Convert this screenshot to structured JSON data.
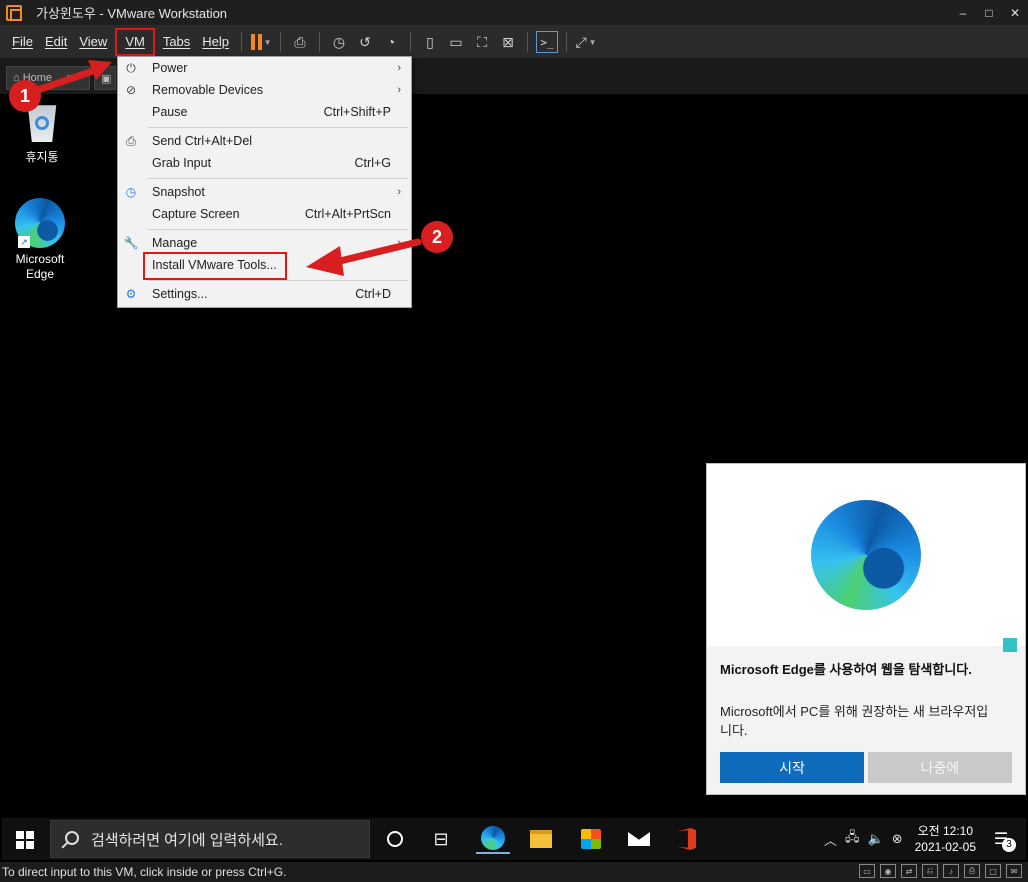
{
  "window": {
    "title": "가상윈도우 - VMware Workstation",
    "controls": [
      "–",
      "□",
      "✕"
    ]
  },
  "menubar": {
    "items": [
      "File",
      "Edit",
      "View",
      "VM",
      "Tabs",
      "Help"
    ]
  },
  "tabs": {
    "home_label": "Home"
  },
  "vm_menu": {
    "items": [
      {
        "label": "Power",
        "shortcut": "",
        "submenu": true,
        "icon": "power-icon"
      },
      {
        "label": "Removable Devices",
        "shortcut": "",
        "submenu": true,
        "icon": "disc-icon"
      },
      {
        "label": "Pause",
        "shortcut": "Ctrl+Shift+P",
        "submenu": false,
        "icon": ""
      },
      {
        "label": "Send Ctrl+Alt+Del",
        "shortcut": "",
        "submenu": false,
        "icon": "keyboard-icon"
      },
      {
        "label": "Grab Input",
        "shortcut": "Ctrl+G",
        "submenu": false,
        "icon": ""
      },
      {
        "label": "Snapshot",
        "shortcut": "",
        "submenu": true,
        "icon": "snapshot-icon"
      },
      {
        "label": "Capture Screen",
        "shortcut": "Ctrl+Alt+PrtScn",
        "submenu": false,
        "icon": ""
      },
      {
        "label": "Manage",
        "shortcut": "",
        "submenu": true,
        "icon": "wrench-icon"
      },
      {
        "label": "Install VMware Tools...",
        "shortcut": "",
        "submenu": false,
        "icon": ""
      },
      {
        "label": "Settings...",
        "shortcut": "Ctrl+D",
        "submenu": false,
        "icon": "settings-icon"
      }
    ]
  },
  "annotations": {
    "step1": "1",
    "step2": "2",
    "color": "#d81f1f"
  },
  "desktop": {
    "icons": [
      {
        "label": "휴지통"
      },
      {
        "label": "Microsoft Edge"
      }
    ]
  },
  "edge_popup": {
    "title": "Microsoft Edge를 사용하여 웹을 탐색합니다.",
    "body": "Microsoft에서 PC를 위해 권장하는 새 브라우저입니다.",
    "primary_button": "시작",
    "secondary_button": "나중에",
    "accent": "#0f6cbd"
  },
  "taskbar": {
    "search_placeholder": "검색하려면 여기에 입력하세요.",
    "clock_time": "오전 12:10",
    "clock_date": "2021-02-05",
    "notification_count": "3"
  },
  "statusbar": {
    "text": "To direct input to this VM, click inside or press Ctrl+G."
  }
}
